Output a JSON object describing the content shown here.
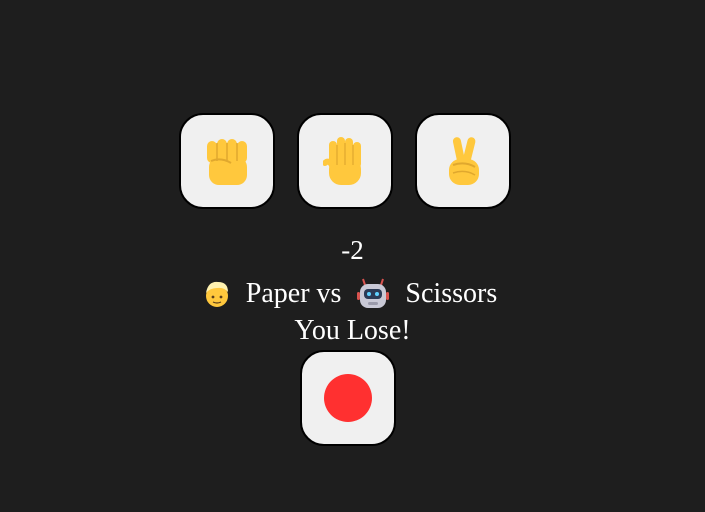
{
  "choices": [
    {
      "name": "rock",
      "icon": "raised-fist-icon"
    },
    {
      "name": "paper",
      "icon": "raised-hand-icon"
    },
    {
      "name": "scissors",
      "icon": "victory-hand-icon"
    }
  ],
  "score": "-2",
  "matchup": {
    "player_icon": "person-icon",
    "player_choice": "Paper vs",
    "computer_icon": "robot-icon",
    "computer_choice": "Scissors"
  },
  "result": "You Lose!",
  "record_button": {
    "icon": "record-dot-icon",
    "color": "#ff3030"
  },
  "colors": {
    "background": "#1e1e1e",
    "button": "#f0f0f0",
    "emoji_yellow": "#ffcc33"
  }
}
